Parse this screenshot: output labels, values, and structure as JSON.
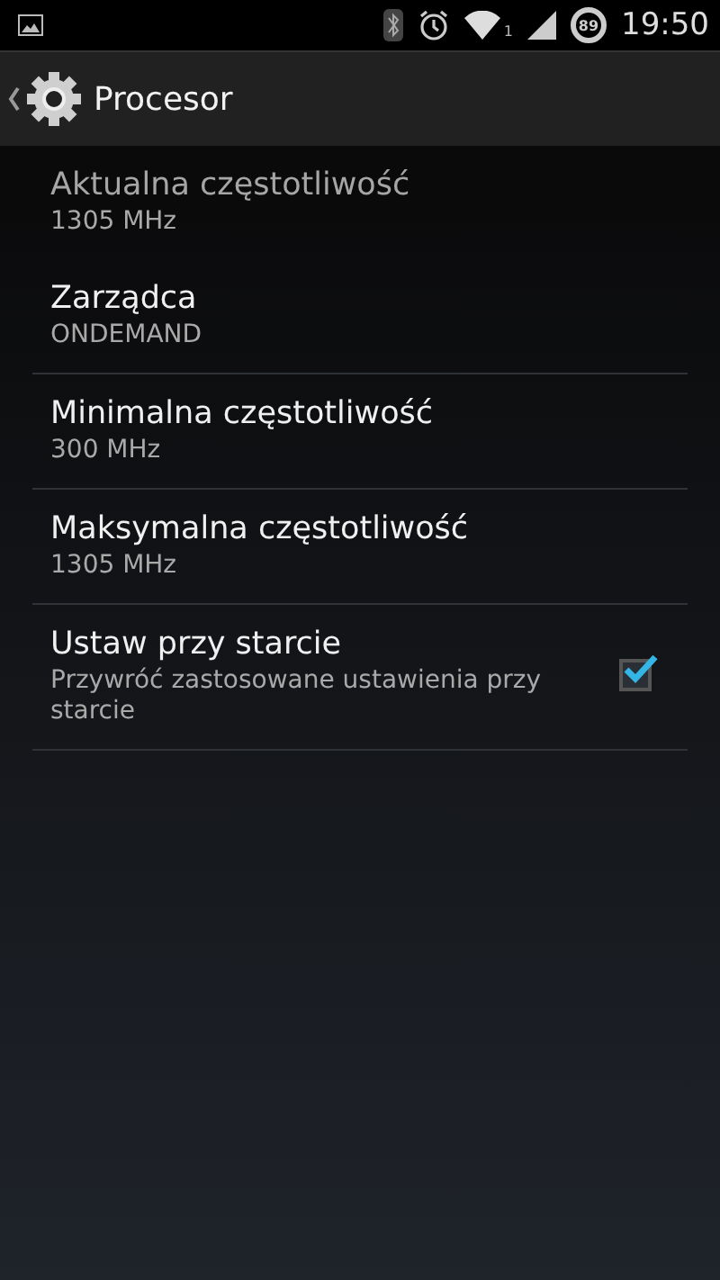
{
  "status_bar": {
    "network_label": "1",
    "battery": "89",
    "time": "19:50"
  },
  "action_bar": {
    "title": "Procesor"
  },
  "preferences": [
    {
      "kind": "text",
      "title": "Aktualna częstotliwość",
      "summary": "1305 MHz",
      "disabled": true
    },
    {
      "kind": "text",
      "title": "Zarządca",
      "summary": "ONDEMAND",
      "disabled": false
    },
    {
      "kind": "text",
      "title": "Minimalna częstotliwość",
      "summary": "300 MHz",
      "disabled": false
    },
    {
      "kind": "text",
      "title": "Maksymalna częstotliwość",
      "summary": "1305 MHz",
      "disabled": false
    },
    {
      "kind": "checkbox",
      "title": "Ustaw przy starcie",
      "summary": "Przywróć zastosowane ustawienia przy starcie",
      "disabled": false,
      "checked": true
    }
  ]
}
